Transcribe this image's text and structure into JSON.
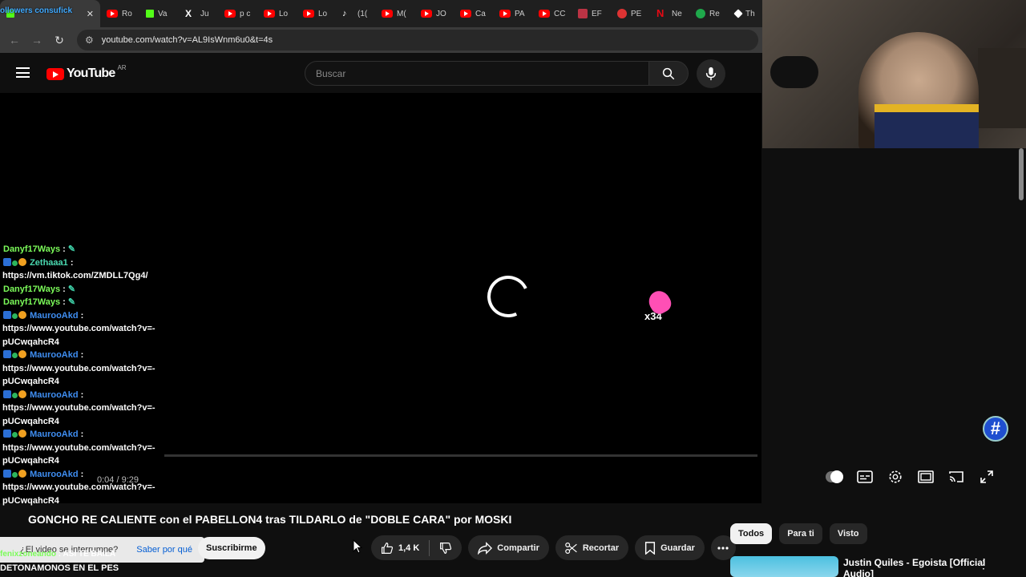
{
  "browser": {
    "tabs": [
      {
        "label": "ollowers consufick",
        "icon": "kick-icon",
        "active": true
      },
      {
        "label": "Ro",
        "icon": "youtube-icon"
      },
      {
        "label": "Va",
        "icon": "kick-icon"
      },
      {
        "label": "Ju",
        "icon": "x-icon"
      },
      {
        "label": "p c",
        "icon": "youtube-icon"
      },
      {
        "label": "Lo",
        "icon": "youtube-icon"
      },
      {
        "label": "Lo",
        "icon": "youtube-icon"
      },
      {
        "label": "(1(",
        "icon": "tiktok-icon"
      },
      {
        "label": "M(",
        "icon": "youtube-icon"
      },
      {
        "label": "JO",
        "icon": "youtube-icon"
      },
      {
        "label": "Ca",
        "icon": "youtube-icon"
      },
      {
        "label": "PA",
        "icon": "youtube-icon"
      },
      {
        "label": "CC",
        "icon": "youtube-icon"
      },
      {
        "label": "EF",
        "icon": "box-icon"
      },
      {
        "label": "PE",
        "icon": "circle-icon"
      },
      {
        "label": "Ne",
        "icon": "netflix-icon"
      },
      {
        "label": "Re",
        "icon": "green-icon"
      },
      {
        "label": "Th",
        "icon": "diamond-icon"
      }
    ],
    "url": "youtube.com/watch?v=AL9IsWnm6u0&t=4s"
  },
  "youtube": {
    "logo_text": "YouTube",
    "country_code": "AR",
    "search_placeholder": "Buscar"
  },
  "player": {
    "emote_count": "x34",
    "time": "0:04 / 9:29",
    "hash_badge": "#"
  },
  "chat": {
    "messages": [
      {
        "user": "Danyf17Ways",
        "sep": " :",
        "text": "",
        "color": "green",
        "emote": true
      },
      {
        "user": "Zethaaa1",
        "sep": " :",
        "text": "https://vm.tiktok.com/ZMDLL7Qg4/",
        "color": "teal",
        "badges": true
      },
      {
        "user": "Danyf17Ways",
        "sep": " :",
        "text": "",
        "color": "green",
        "emote": true
      },
      {
        "user": "Danyf17Ways",
        "sep": " :",
        "text": "",
        "color": "green",
        "emote": true
      },
      {
        "user": "MaurooAkd",
        "sep": " :",
        "text": "https://www.youtube.com/watch?v=-pUCwqahcR4",
        "color": "blue",
        "badges": true
      },
      {
        "user": "MaurooAkd",
        "sep": " :",
        "text": "https://www.youtube.com/watch?v=-pUCwqahcR4",
        "color": "blue",
        "badges": true
      },
      {
        "user": "MaurooAkd",
        "sep": " :",
        "text": "https://www.youtube.com/watch?v=-pUCwqahcR4",
        "color": "blue",
        "badges": true
      },
      {
        "user": "MaurooAkd",
        "sep": " :",
        "text": "https://www.youtube.com/watch?v=-pUCwqahcR4",
        "color": "blue",
        "badges": true
      },
      {
        "user": "MaurooAkd",
        "sep": " :",
        "text": "https://www.youtube.com/watch?v=-pUCwqahcR4",
        "color": "blue",
        "badges": true
      }
    ],
    "tail_user": "fenixzoneando",
    "tail_text": " : ASI TE BAILA",
    "bottom_text": "DETONAMONOS EN EL PES"
  },
  "video": {
    "title": "GONCHO RE CALIENTE con el PABELLON4 tras TILDARLO de \"DOBLE CARA\" por MOSKI",
    "notice_text": "¿El video se interrumpe?",
    "notice_link": "Saber por qué",
    "subscribe": "Suscribirme",
    "likes": "1,4 K",
    "share": "Compartir",
    "clip": "Recortar",
    "save": "Guardar"
  },
  "sidebar": {
    "chips": [
      "Todos",
      "Para ti",
      "Visto"
    ],
    "recommendation_title": "Justin Quiles - Egoista [Official Audio]"
  },
  "colors": {
    "youtube_red": "#ff0000",
    "chat_green": "#7cfc5a",
    "chat_blue": "#3f8ef2",
    "link_blue": "#065fd4"
  }
}
